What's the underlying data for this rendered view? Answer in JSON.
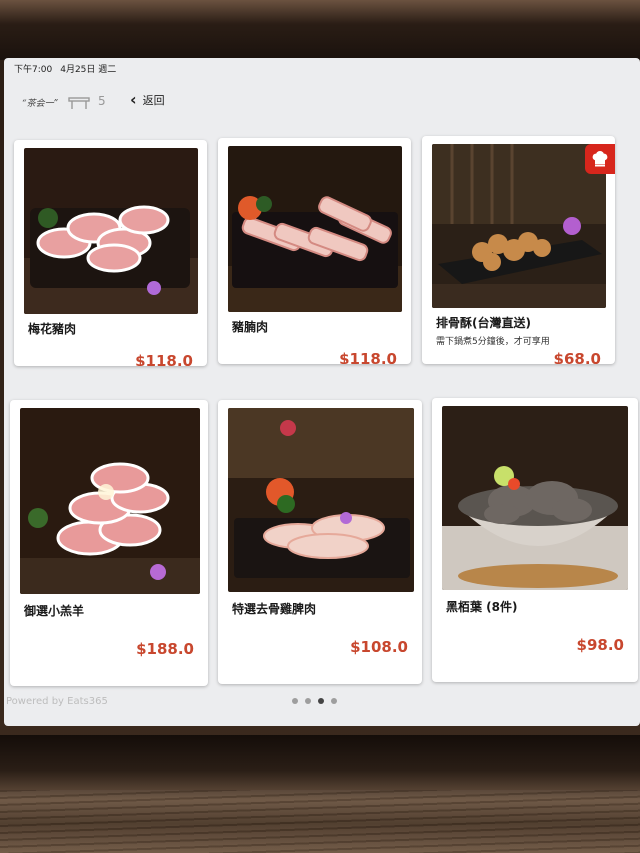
{
  "statusbar": {
    "time": "下午7:00",
    "date": "4月25日 週二"
  },
  "topbar": {
    "logo_text": "“茶会一”",
    "table_count": "5",
    "back_label": "返回"
  },
  "items": [
    {
      "name": "梅花豬肉",
      "desc": "",
      "price": "$118.0"
    },
    {
      "name": "豬腩肉",
      "desc": "",
      "price": "$118.0"
    },
    {
      "name": "排骨酥(台灣直送)",
      "desc": "需下鍋煮5分鐘後，才可享用",
      "price": "$68.0"
    },
    {
      "name": "御選小羔羊",
      "desc": "",
      "price": "$188.0"
    },
    {
      "name": "特選去骨雞脾肉",
      "desc": "",
      "price": "$108.0"
    },
    {
      "name": "黑栢葉 (8件)",
      "desc": "",
      "price": "$98.0"
    }
  ],
  "footer": {
    "powered_by": "Powered by Eats365",
    "pages": 4,
    "active_page": 3
  },
  "colors": {
    "price": "#c8472e",
    "badge": "#d7261c"
  }
}
